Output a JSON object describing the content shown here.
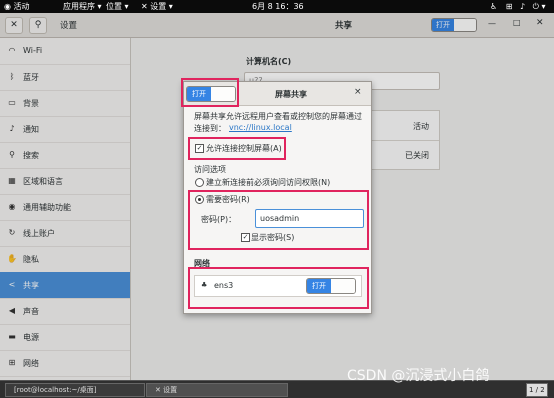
{
  "topbar": {
    "activities": "活动",
    "apps": "应用程序",
    "places": "位置",
    "settings": "设置",
    "clock": "6月 8 16：36"
  },
  "header": {
    "settings_title": "设置",
    "panel_title": "共享",
    "share_switch": "打开"
  },
  "sidebar": {
    "items": [
      {
        "label": "Wi-Fi",
        "icon": "wifi-icon"
      },
      {
        "label": "蓝牙",
        "icon": "bluetooth-icon"
      },
      {
        "label": "背景",
        "icon": "background-icon"
      },
      {
        "label": "通知",
        "icon": "bell-icon"
      },
      {
        "label": "搜索",
        "icon": "search-icon"
      },
      {
        "label": "区域和语言",
        "icon": "globe-icon"
      },
      {
        "label": "通用辅助功能",
        "icon": "accessibility-icon"
      },
      {
        "label": "线上账户",
        "icon": "online-accounts-icon"
      },
      {
        "label": "隐私",
        "icon": "privacy-icon"
      },
      {
        "label": "共享",
        "icon": "share-icon"
      },
      {
        "label": "声音",
        "icon": "speaker-icon"
      },
      {
        "label": "电源",
        "icon": "power-icon"
      },
      {
        "label": "网络",
        "icon": "network-icon"
      }
    ]
  },
  "main": {
    "computer_name_label": "计算机名(C)",
    "computer_name_value": "u??",
    "row1_status": "活动",
    "row2_status": "已关闭"
  },
  "dialog": {
    "title": "屏幕共享",
    "toggle_label": "打开",
    "close": "×",
    "description": "屏幕共享允许远程用户查看或控制您的屏幕通过",
    "connect_prefix": "连接到：",
    "vnc_link": "vnc://linux.local",
    "allow_control": "允许连接控制屏幕(A)",
    "access_options": "访问选项",
    "option_confirm": "建立新连接前必须询问访问权限(N)",
    "option_password": "需要密码(R)",
    "password_label": "密码(P)：",
    "password_value": "uosadmin",
    "show_password": "显示密码(S)",
    "network_section": "网络",
    "network_name": "ens3",
    "network_switch": "打开"
  },
  "taskbar": {
    "terminal": "[root@localhost:~/桌面]",
    "settings": "设置",
    "workspace": "1 / 2"
  },
  "watermark": "CSDN @沉浸式小白鸽",
  "colors": {
    "accent": "#3584e4",
    "highlight": "#e0245e",
    "selected": "#4a90d9"
  }
}
